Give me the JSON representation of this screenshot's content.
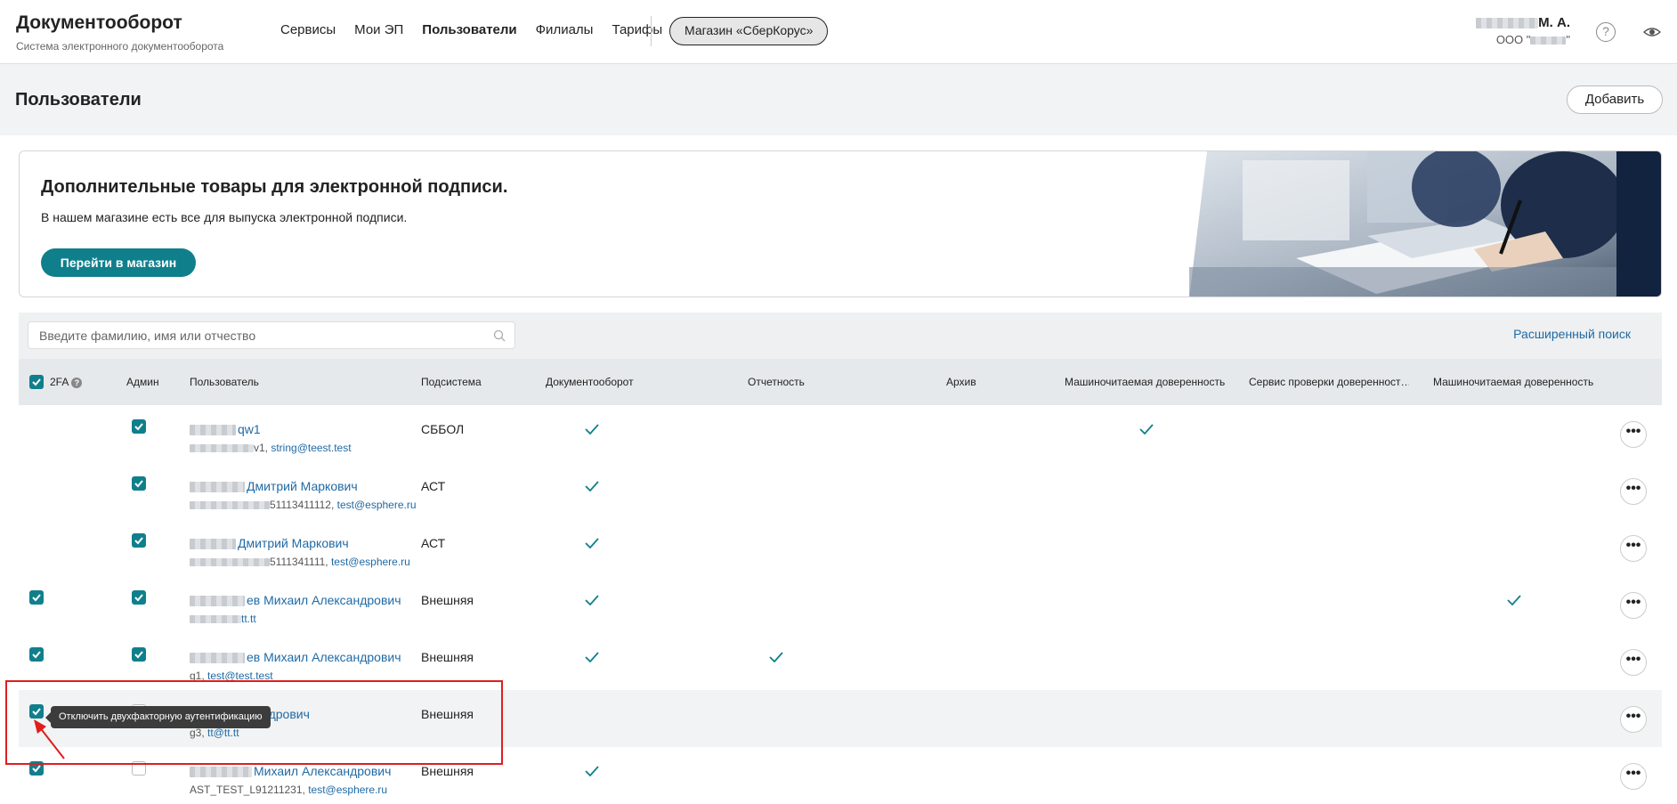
{
  "app": {
    "title": "Документооборот",
    "subtitle": "Система электронного документооборота"
  },
  "nav": {
    "items": [
      "Сервисы",
      "Мои ЭП",
      "Пользователи",
      "Филиалы",
      "Тарифы"
    ],
    "active": "Пользователи",
    "shop_label": "Магазин «СберКорус»"
  },
  "user": {
    "name_suffix": "М. А.",
    "org_prefix": "ООО \"",
    "org_suffix": "\""
  },
  "page": {
    "title": "Пользователи",
    "add_label": "Добавить"
  },
  "banner": {
    "title": "Дополнительные товары для электронной подписи.",
    "text": "В нашем магазине есть все для выпуска электронной подписи.",
    "button": "Перейти в магазин"
  },
  "search": {
    "placeholder": "Введите фамилию, имя или отчество",
    "advanced": "Расширенный поиск"
  },
  "table": {
    "headers": [
      "2FA",
      "Админ",
      "Пользователь",
      "Подсистема",
      "Документооборот",
      "Отчетность",
      "Архив",
      "Машиночитаемая доверенность",
      "Сервис проверки доверенност…",
      "Машиночитаемая доверенность"
    ],
    "rows": [
      {
        "twofa": false,
        "admin": true,
        "name": "qw1",
        "sub_login": "v1, ",
        "email": "string@teest.test",
        "subsystem": "СББОЛ",
        "doc": true,
        "report": false,
        "mchd": true,
        "mchd2": false
      },
      {
        "twofa": false,
        "admin": true,
        "name": "Дмитрий Маркович",
        "sub_login": "51113411112, ",
        "email": "test@esphere.ru",
        "subsystem": "АСТ",
        "doc": true,
        "report": false,
        "mchd": false,
        "mchd2": false
      },
      {
        "twofa": false,
        "admin": true,
        "name": "Дмитрий Маркович",
        "sub_login": "5111341111, ",
        "email": "test@esphere.ru",
        "subsystem": "АСТ",
        "doc": true,
        "report": false,
        "mchd": false,
        "mchd2": false
      },
      {
        "twofa": true,
        "admin": true,
        "name": "ев Михаил Александрович",
        "sub_login": "",
        "email": "tt.tt",
        "subsystem": "Внешняя",
        "doc": true,
        "report": false,
        "mchd": false,
        "mchd2": true
      },
      {
        "twofa": true,
        "admin": true,
        "name": "ев Михаил Александрович",
        "sub_login": "g1, ",
        "email": "test@test.test",
        "subsystem": "Внешняя",
        "doc": true,
        "report": true,
        "mchd": false,
        "mchd2": false
      },
      {
        "twofa": true,
        "admin": false,
        "name": "хаил Александрович",
        "sub_login": "g3, ",
        "email": "tt@tt.tt",
        "subsystem": "Внешняя",
        "doc": false,
        "report": false,
        "mchd": false,
        "mchd2": false
      },
      {
        "twofa": true,
        "admin": false,
        "name": "Михаил Александрович",
        "sub_login": "AST_TEST_L91211231, ",
        "email": "test@esphere.ru",
        "subsystem": "Внешняя",
        "doc": true,
        "report": false,
        "mchd": false,
        "mchd2": false
      }
    ]
  },
  "tooltip": "Отключить двухфакторную аутентификацию",
  "more_label": "•••",
  "colors": {
    "accent": "#107f8c",
    "link": "#1f6aa5",
    "highlight": "#e11d1d"
  }
}
